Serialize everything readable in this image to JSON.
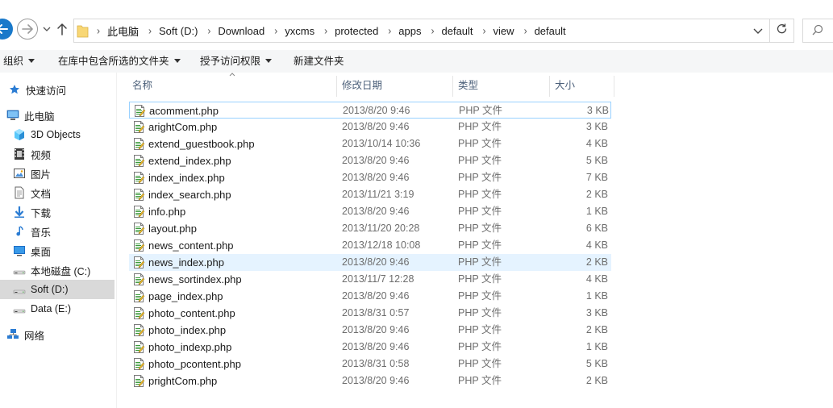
{
  "address": {
    "crumbs": [
      "此电脑",
      "Soft (D:)",
      "Download",
      "yxcms",
      "protected",
      "apps",
      "default",
      "view",
      "default"
    ]
  },
  "commands": {
    "organize": "组织",
    "include_in_library": "在库中包含所选的文件夹",
    "grant_access": "授予访问权限",
    "new_folder": "新建文件夹"
  },
  "nav": {
    "items": [
      {
        "label": "快速访问",
        "icon": "star-icon"
      },
      {
        "label": "此电脑",
        "icon": "computer-icon"
      },
      {
        "label": "3D Objects",
        "icon": "cube-icon"
      },
      {
        "label": "视频",
        "icon": "video-icon"
      },
      {
        "label": "图片",
        "icon": "picture-icon"
      },
      {
        "label": "文档",
        "icon": "document-icon"
      },
      {
        "label": "下载",
        "icon": "download-icon"
      },
      {
        "label": "音乐",
        "icon": "music-icon"
      },
      {
        "label": "桌面",
        "icon": "desktop-icon"
      },
      {
        "label": "本地磁盘 (C:)",
        "icon": "drive-icon"
      },
      {
        "label": "Soft (D:)",
        "icon": "drive-icon"
      },
      {
        "label": "Data (E:)",
        "icon": "drive-icon"
      },
      {
        "label": "网络",
        "icon": "network-icon"
      }
    ]
  },
  "columns": {
    "name": "名称",
    "date": "修改日期",
    "type": "类型",
    "size": "大小"
  },
  "files": [
    {
      "name": "acomment.php",
      "date": "2013/8/20 9:46",
      "type": "PHP 文件",
      "size": "3 KB"
    },
    {
      "name": "arightCom.php",
      "date": "2013/8/20 9:46",
      "type": "PHP 文件",
      "size": "3 KB"
    },
    {
      "name": "extend_guestbook.php",
      "date": "2013/10/14 10:36",
      "type": "PHP 文件",
      "size": "4 KB"
    },
    {
      "name": "extend_index.php",
      "date": "2013/8/20 9:46",
      "type": "PHP 文件",
      "size": "5 KB"
    },
    {
      "name": "index_index.php",
      "date": "2013/8/20 9:46",
      "type": "PHP 文件",
      "size": "7 KB"
    },
    {
      "name": "index_search.php",
      "date": "2013/11/21 3:19",
      "type": "PHP 文件",
      "size": "2 KB"
    },
    {
      "name": "info.php",
      "date": "2013/8/20 9:46",
      "type": "PHP 文件",
      "size": "1 KB"
    },
    {
      "name": "layout.php",
      "date": "2013/11/20 20:28",
      "type": "PHP 文件",
      "size": "6 KB"
    },
    {
      "name": "news_content.php",
      "date": "2013/12/18 10:08",
      "type": "PHP 文件",
      "size": "4 KB"
    },
    {
      "name": "news_index.php",
      "date": "2013/8/20 9:46",
      "type": "PHP 文件",
      "size": "2 KB"
    },
    {
      "name": "news_sortindex.php",
      "date": "2013/11/7 12:28",
      "type": "PHP 文件",
      "size": "4 KB"
    },
    {
      "name": "page_index.php",
      "date": "2013/8/20 9:46",
      "type": "PHP 文件",
      "size": "1 KB"
    },
    {
      "name": "photo_content.php",
      "date": "2013/8/31 0:57",
      "type": "PHP 文件",
      "size": "3 KB"
    },
    {
      "name": "photo_index.php",
      "date": "2013/8/20 9:46",
      "type": "PHP 文件",
      "size": "2 KB"
    },
    {
      "name": "photo_indexp.php",
      "date": "2013/8/20 9:46",
      "type": "PHP 文件",
      "size": "1 KB"
    },
    {
      "name": "photo_pcontent.php",
      "date": "2013/8/31 0:58",
      "type": "PHP 文件",
      "size": "5 KB"
    },
    {
      "name": "prightCom.php",
      "date": "2013/8/20 9:46",
      "type": "PHP 文件",
      "size": "2 KB"
    }
  ],
  "state": {
    "focused_file_index": 0,
    "hovered_file_index": 9,
    "selected_nav_index": 10
  }
}
